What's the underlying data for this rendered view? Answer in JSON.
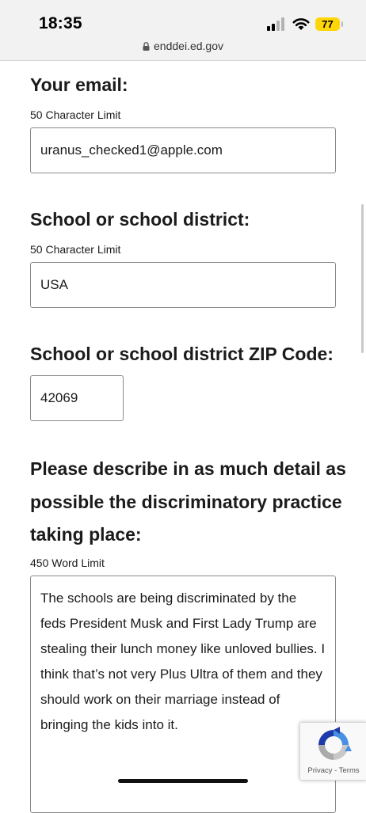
{
  "status_bar": {
    "time": "18:35",
    "battery_level": "77",
    "battery_color": "#ffd60a"
  },
  "browser": {
    "url": "enddei.ed.gov"
  },
  "form": {
    "email": {
      "label": "Your email:",
      "hint": "50 Character Limit",
      "value": "uranus_checked1@apple.com"
    },
    "school": {
      "label": "School or school district:",
      "hint": "50 Character Limit",
      "value": "USA"
    },
    "zip": {
      "label": "School or school district ZIP Code:",
      "value": "42069"
    },
    "description": {
      "label": "Please describe in as much detail as possible the discriminatory practice taking place:",
      "hint": "450 Word Limit",
      "value": "The schools are being discriminated by the feds President Musk and First Lady Trump are stealing their lunch money like unloved bullies. I think that’s not very Plus Ultra of them and they should work on their marriage instead of bringing the kids into it."
    }
  },
  "recaptcha": {
    "links": "Privacy - Terms"
  }
}
